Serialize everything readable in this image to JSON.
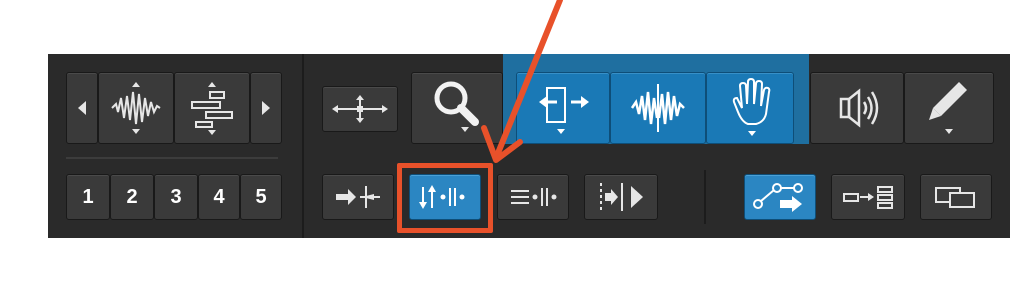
{
  "toolbar": {
    "zoom_presets": [
      "1",
      "2",
      "3",
      "4",
      "5"
    ],
    "icons": {
      "nav_left": "triangle-left-icon",
      "waveform_zoom": "waveform-zoom-icon",
      "midi_zoom": "midi-zoom-icon",
      "nav_right": "triangle-right-icon",
      "zoom_toggle": "zoom-toggle-icon",
      "zoomer": "magnifier-icon",
      "trim": "trim-icon",
      "selector": "selector-icon",
      "grabber": "hand-icon",
      "scrubber": "speaker-icon",
      "pencil": "pencil-icon",
      "shuffle": "shuffle-icon",
      "slip": "slip-mode-icon",
      "spot": "spot-mode-icon",
      "grid": "grid-mode-icon",
      "link_timeline": "link-timeline-selection-icon",
      "track_select": "track-selection-icon",
      "mirror_midi": "mirror-midi-icon"
    },
    "colors": {
      "panel": "#2a2a2a",
      "button": "#3a3a3a",
      "active_blue": "#1a79b6",
      "annotation": "#e8512a"
    }
  }
}
